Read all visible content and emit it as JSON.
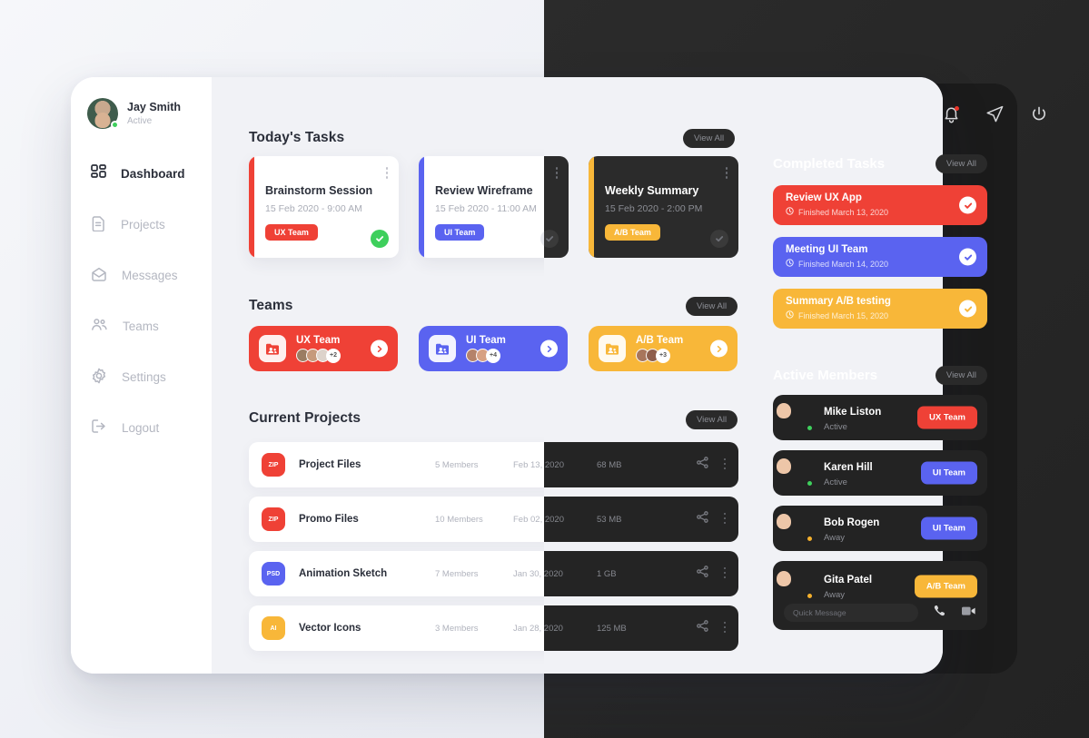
{
  "colors": {
    "red": "#ef4136",
    "blue": "#5a63f0",
    "yellow": "#f8b739",
    "green": "#3ecf5c",
    "dark_bg": "#1b1b1b",
    "light_bg": "#f1f2f6"
  },
  "sidebar": {
    "profile": {
      "name": "Jay Smith",
      "status": "Active"
    },
    "items": [
      {
        "label": "Dashboard",
        "icon": "grid-icon",
        "active": true
      },
      {
        "label": "Projects",
        "icon": "document-icon",
        "active": false
      },
      {
        "label": "Messages",
        "icon": "envelope-icon",
        "active": false
      },
      {
        "label": "Teams",
        "icon": "people-icon",
        "active": false
      },
      {
        "label": "Settings",
        "icon": "gear-icon",
        "active": false
      },
      {
        "label": "Logout",
        "icon": "logout-icon",
        "active": false
      }
    ]
  },
  "header": {
    "icons": [
      "notification-bell-icon",
      "send-icon",
      "power-icon"
    ]
  },
  "todays_tasks": {
    "title": "Today's Tasks",
    "view_all": "View All",
    "items": [
      {
        "title": "Brainstorm Session",
        "time": "15 Feb 2020 - 9:00 AM",
        "team": "UX Team",
        "color": "#ef4136",
        "done": true
      },
      {
        "title": "Review Wireframe",
        "time": "15 Feb 2020 - 11:00 AM",
        "team": "UI Team",
        "color": "#5a63f0",
        "done": false
      },
      {
        "title": "Weekly Summary",
        "time": "15 Feb 2020 - 2:00 PM",
        "team": "A/B Team",
        "color": "#f8b739",
        "done": false
      }
    ]
  },
  "teams": {
    "title": "Teams",
    "view_all": "View All",
    "items": [
      {
        "name": "UX Team",
        "extra": "+2",
        "color": "#ef4136"
      },
      {
        "name": "UI Team",
        "extra": "+4",
        "color": "#5a63f0"
      },
      {
        "name": "A/B Team",
        "extra": "+3",
        "color": "#f8b739"
      }
    ]
  },
  "current_projects": {
    "title": "Current Projects",
    "view_all": "View All",
    "rows": [
      {
        "type": "ZIP",
        "name": "Project Files",
        "members": "5 Members",
        "date": "Feb 13, 2020",
        "size": "68 MB",
        "color": "#ef4136"
      },
      {
        "type": "ZIP",
        "name": "Promo Files",
        "members": "10 Members",
        "date": "Feb 02, 2020",
        "size": "53 MB",
        "color": "#ef4136"
      },
      {
        "type": "PSD",
        "name": "Animation Sketch",
        "members": "7 Members",
        "date": "Jan 30, 2020",
        "size": "1 GB",
        "color": "#5a63f0"
      },
      {
        "type": "AI",
        "name": "Vector Icons",
        "members": "3 Members",
        "date": "Jan 28, 2020",
        "size": "125 MB",
        "color": "#f8b739"
      }
    ]
  },
  "completed_tasks": {
    "title": "Completed Tasks",
    "view_all": "View All",
    "items": [
      {
        "title": "Review UX App",
        "finished": "Finished March 13, 2020",
        "color": "#ef4136"
      },
      {
        "title": "Meeting UI Team",
        "finished": "Finished March 14, 2020",
        "color": "#5a63f0"
      },
      {
        "title": "Summary A/B testing",
        "finished": "Finished March 15, 2020",
        "color": "#f8b739"
      }
    ]
  },
  "active_members": {
    "title": "Active Members",
    "view_all": "View All",
    "items": [
      {
        "name": "Mike Liston",
        "status": "Active",
        "team": "UX Team",
        "color": "#ef4136",
        "online": true
      },
      {
        "name": "Karen Hill",
        "status": "Active",
        "team": "UI Team",
        "color": "#5a63f0",
        "online": true
      },
      {
        "name": "Bob Rogen",
        "status": "Away",
        "team": "UI Team",
        "color": "#5a63f0",
        "online": false
      },
      {
        "name": "Gita Patel",
        "status": "Away",
        "team": "A/B Team",
        "color": "#f8b739",
        "online": false
      }
    ],
    "quick_message_placeholder": "Quick Message",
    "call_icon": "phone-icon",
    "video_icon": "video-icon"
  }
}
